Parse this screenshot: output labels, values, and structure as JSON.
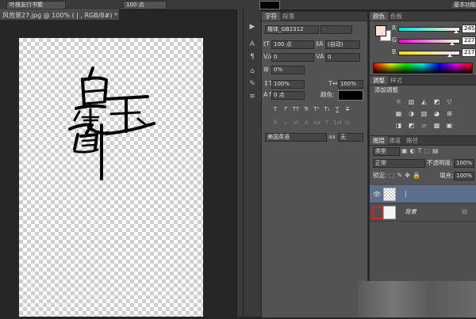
{
  "options_bar": {
    "font_field": "叶根友行书繁",
    "size_field": "100 点",
    "right_button": "基本功能"
  },
  "document": {
    "tab_title": "风背景27.jpg @ 100% ( | , RGB/8#) *",
    "close_glyph": "×",
    "artwork_text": "白玉霓"
  },
  "character_panel": {
    "tabs": [
      "字符",
      "段落"
    ],
    "font_family": "楷体_GB2312",
    "font_style": "-",
    "font_size": "100 点",
    "leading": "(自动)",
    "kerning": "0",
    "tracking": "0",
    "tsume": "0%",
    "vertical_scale": "100%",
    "horizontal_scale": "100%",
    "baseline_shift": "0 点",
    "color_label": "颜色:",
    "text_color": "#000000",
    "style_buttons": [
      "T",
      "T",
      "TT",
      "Tr",
      "T¹",
      "T₁",
      "T",
      "T"
    ],
    "opentype_buttons": [
      "fi",
      "ℴ",
      "st",
      "A",
      "aa",
      "T",
      "1st",
      "½"
    ],
    "language": "美国英语",
    "antialias_icon": "aa",
    "antialias": "无"
  },
  "color_panel": {
    "tabs": [
      "颜色",
      "色板"
    ],
    "r_label": "R",
    "g_label": "G",
    "b_label": "B",
    "r_value": "245",
    "g_value": "227",
    "b_value": "217",
    "r_level": 0.96,
    "g_level": 0.89,
    "b_level": 0.85,
    "foreground": "#f5e3d9",
    "background": "#ffffff"
  },
  "adjustments_panel": {
    "tabs": [
      "调整",
      "样式"
    ],
    "title": "添加调整",
    "row1": [
      "☼",
      "▥",
      "◭",
      "◩",
      "▽"
    ],
    "row2": [
      "▦",
      "◑",
      "▨",
      "◕",
      "⊞"
    ],
    "row3": [
      "◨",
      "◩",
      "▱",
      "▩",
      "▣"
    ]
  },
  "layers_panel": {
    "tabs": [
      "图层",
      "通道",
      "路径"
    ],
    "filter_kind": "类型",
    "blend_mode": "正常",
    "opacity_label": "不透明度:",
    "opacity": "100%",
    "lock_label": "锁定:",
    "fill_label": "填充:",
    "fill": "100%",
    "layers": [
      {
        "name": "|",
        "type": "text",
        "selected": true
      },
      {
        "name": "背景",
        "type": "image",
        "selected": false
      }
    ],
    "lock_icon": "🔒"
  },
  "icons": {
    "visibility": "eye-icon",
    "lock": "lock-icon",
    "dock": [
      "play-icon",
      "text-icon",
      "paragraph-icon",
      "history-icon",
      "brush-icon",
      "layers-icon"
    ]
  },
  "colors": {
    "workspace": "#262626",
    "panel": "#535353",
    "selected_layer": "#5d6f8c",
    "highlight_red": "#e02020"
  }
}
